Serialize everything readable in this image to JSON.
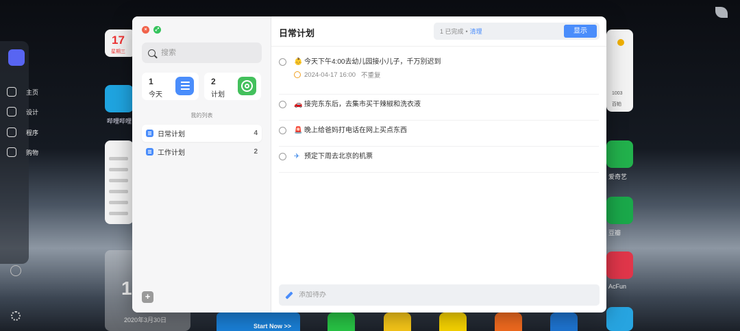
{
  "background": {
    "nav": [
      "主页",
      "设计",
      "程序",
      "购物"
    ],
    "calendar_day": "17",
    "calendar_weekday": "星期三",
    "tv_label": "哔哩哔哩",
    "big_date": "1",
    "big_date_sub": "2020年3月30日",
    "start_label": "Start Now >>",
    "right_labels": [
      "爱奇艺",
      "豆瓣",
      "AcFun"
    ],
    "weather_value": "1003",
    "weather_sub": "百帕"
  },
  "app": {
    "search_placeholder": "搜索",
    "cards": [
      {
        "count": "1",
        "label": "今天",
        "icon": "list-icon"
      },
      {
        "count": "2",
        "label": "计划",
        "icon": "target-icon"
      }
    ],
    "section_title": "我的列表",
    "lists": [
      {
        "name": "日常计划",
        "count": "4",
        "active": true
      },
      {
        "name": "工作计划",
        "count": "2",
        "active": false
      }
    ],
    "add_list_label": "+",
    "header_title": "日常计划",
    "done_text": "1 已完成",
    "done_sep": "•",
    "clear_label": "清理",
    "show_label": "显示",
    "todos": [
      {
        "emoji": "👶",
        "text": "今天下午4:00去幼儿园接小儿子，千万别迟到",
        "date": "2024-04-17 16:00",
        "repeat": "不重复"
      },
      {
        "emoji": "🚗",
        "text": "接完东东后，去集市买干辣椒和洗衣液"
      },
      {
        "emoji": "🚨",
        "text": "晚上给爸妈打电话在网上买点东西"
      },
      {
        "emoji": "✈",
        "text": "预定下周去北京的机票"
      }
    ],
    "add_todo_placeholder": "添加待办",
    "colors": {
      "accent": "#4a8dfb",
      "close": "#f1634b",
      "zoom": "#35c35c",
      "plan_green": "#43c05c"
    }
  }
}
